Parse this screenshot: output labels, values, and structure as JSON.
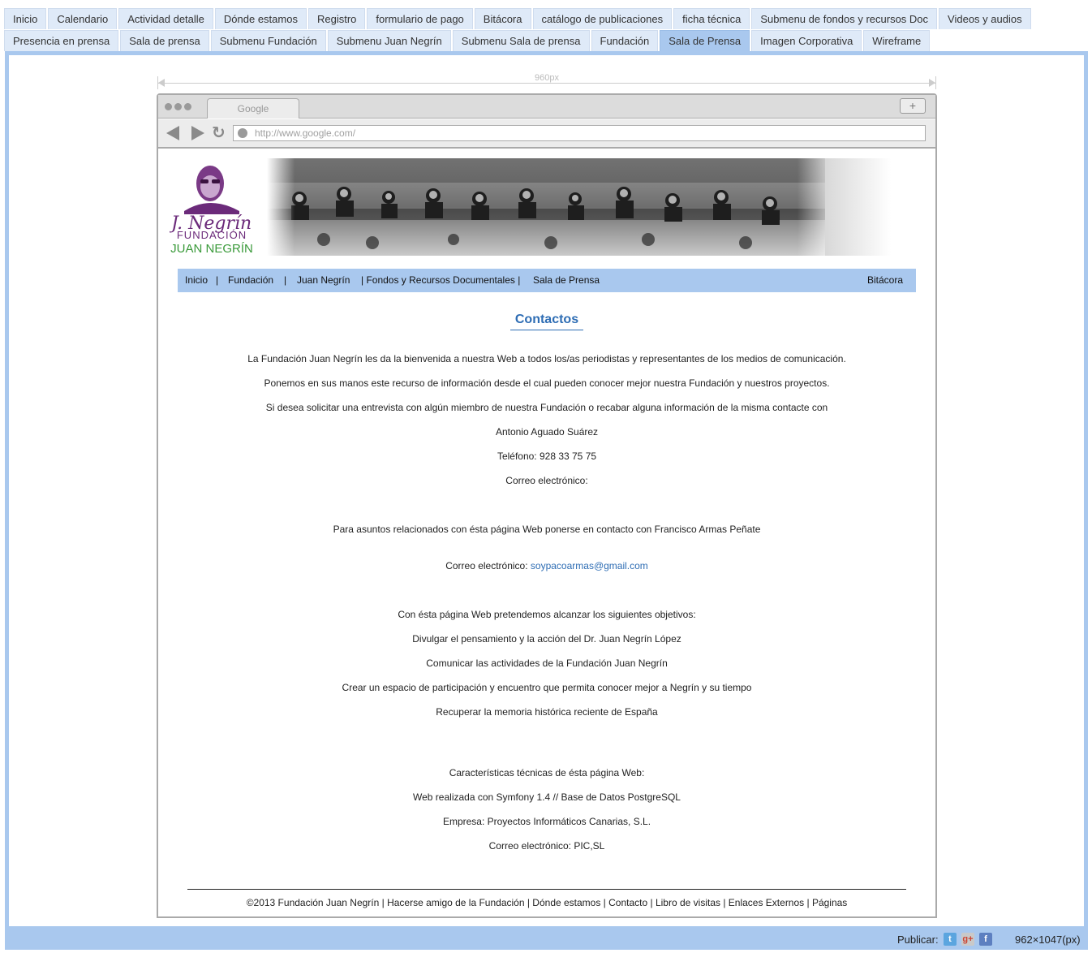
{
  "tabs_row1": [
    "Inicio",
    "Calendario",
    "Actividad detalle",
    "Dónde estamos",
    "Registro",
    "formulario de pago",
    "Bitácora",
    "catálogo de publicaciones",
    "ficha técnica",
    "Submenu de fondos y recursos Doc",
    "Videos y audios"
  ],
  "tabs_row2": [
    "Presencia en prensa",
    "Sala de prensa",
    "Submenu Fundación",
    "Submenu Juan Negrín",
    "Submenu Sala de prensa",
    "Fundación",
    "Sala de Prensa",
    "Imagen Corporativa",
    "Wireframe"
  ],
  "active_tab": "Sala de Prensa",
  "ruler_label": "960px",
  "browser": {
    "tab_title": "Google",
    "plus": "+",
    "url": "http://www.google.com/"
  },
  "logo": {
    "signature": "J. Negrín",
    "line1": "FUNDACIÓN",
    "line2": "JUAN NEGRÍN"
  },
  "site_menu": {
    "inicio": "Inicio",
    "sep1": "|",
    "fundacion": "Fundación",
    "sep2": "|",
    "juan_negrin": "Juan Negrín",
    "fondos": "| Fondos y Recursos Documentales |",
    "sala_prensa": "Sala de Prensa",
    "bitacora": "Bitácora"
  },
  "heading": "Contactos",
  "content": {
    "p1": "La Fundación Juan Negrín les da la bienvenida a nuestra Web a todos los/as periodistas y representantes de los medios de comunicación.",
    "p2": "Ponemos en sus manos este recurso de información desde el cual pueden conocer mejor nuestra Fundación y nuestros proyectos.",
    "p3": "Si desea solicitar una entrevista con algún miembro de nuestra Fundación o recabar alguna información  de la misma contacte con",
    "p4": "Antonio Aguado Suárez",
    "p5": "Teléfono: 928 33 75 75",
    "p6": "Correo electrónico:",
    "p7": "Para asuntos relacionados con ésta página Web ponerse en contacto con Francisco Armas Peñate",
    "p8_label": "Correo electrónico: ",
    "p8_email": "soypacoarmas@gmail.com",
    "p9": "Con ésta página Web pretendemos alcanzar los siguientes objetivos:",
    "p10": "Divulgar el pensamiento y la acción del Dr. Juan Negrín López",
    "p11": "Comunicar las actividades de la Fundación Juan Negrín",
    "p12": "Crear un espacio de participación y encuentro que permita conocer mejor a Negrín y su tiempo",
    "p13": "Recuperar la memoria histórica reciente de España",
    "p14": "Características técnicas de ésta página Web:",
    "p15": "Web realizada con Symfony 1.4 // Base de Datos PostgreSQL",
    "p16": "Empresa: Proyectos Informáticos Canarias, S.L.",
    "p17": "Correo electrónico: PIC,SL"
  },
  "footer": "©2013 Fundación Juan Negrín | Hacerse amigo de la Fundación | Dónde estamos | Contacto | Libro de visitas | Enlaces Externos | Páginas",
  "bottom_bar": {
    "publish_label": "Publicar:",
    "twitter_glyph": "t",
    "gplus_glyph": "g+",
    "facebook_glyph": "f",
    "dimensions": "962×1047(px)"
  },
  "colors": {
    "accent": "#a9c8ee",
    "tab_bg": "#dfeaf8",
    "link": "#2e6db4",
    "logo_purple": "#6b2a7a",
    "logo_green": "#3a9a3a"
  }
}
